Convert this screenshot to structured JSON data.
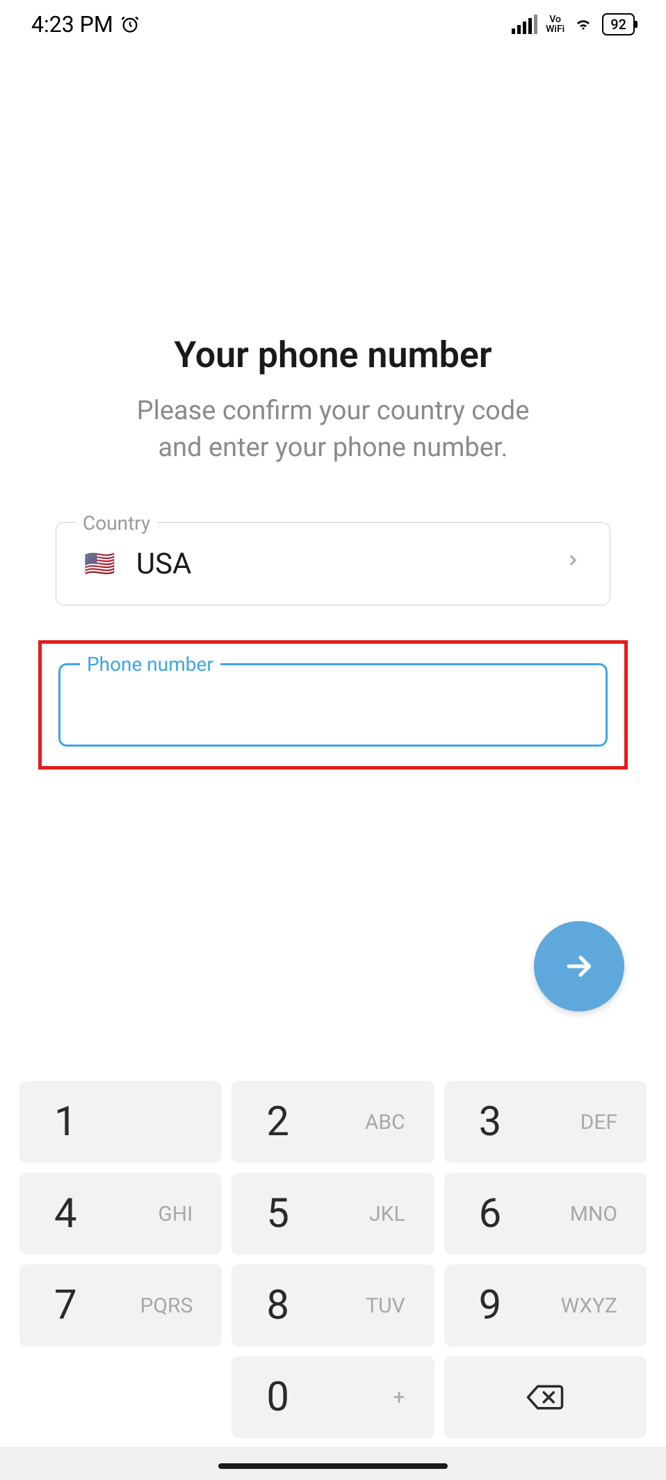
{
  "status_bar": {
    "time": "4:23 PM",
    "vowifi_top": "Vo",
    "vowifi_bottom": "WiFi",
    "battery": "92"
  },
  "title": "Your phone number",
  "subtitle": "Please confirm your country code\nand enter your phone number.",
  "country": {
    "label": "Country",
    "flag": "🇺🇸",
    "name": "USA"
  },
  "phone": {
    "label": "Phone number",
    "value": ""
  },
  "keypad": {
    "keys": [
      {
        "digit": "1",
        "letters": ""
      },
      {
        "digit": "2",
        "letters": "ABC"
      },
      {
        "digit": "3",
        "letters": "DEF"
      },
      {
        "digit": "4",
        "letters": "GHI"
      },
      {
        "digit": "5",
        "letters": "JKL"
      },
      {
        "digit": "6",
        "letters": "MNO"
      },
      {
        "digit": "7",
        "letters": "PQRS"
      },
      {
        "digit": "8",
        "letters": "TUV"
      },
      {
        "digit": "9",
        "letters": "WXYZ"
      },
      {
        "digit": "",
        "letters": ""
      },
      {
        "digit": "0",
        "letters": "+"
      },
      {
        "digit": "⌫",
        "letters": ""
      }
    ]
  }
}
